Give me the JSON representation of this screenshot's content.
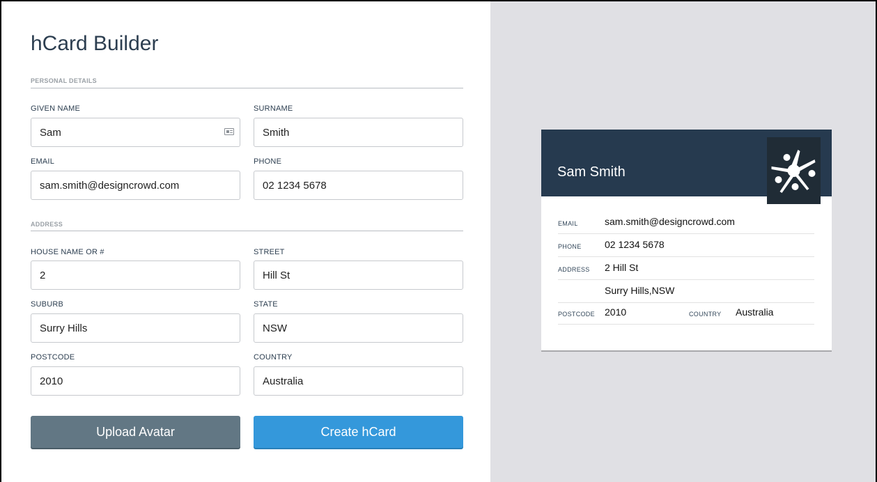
{
  "builder": {
    "title": "hCard Builder",
    "personal_section": "PERSONAL DETAILS",
    "address_section": "ADDRESS",
    "fields": {
      "given_name": {
        "label": "GIVEN NAME",
        "value": "Sam"
      },
      "surname": {
        "label": "SURNAME",
        "value": "Smith"
      },
      "email": {
        "label": "EMAIL",
        "value": "sam.smith@designcrowd.com"
      },
      "phone": {
        "label": "PHONE",
        "value": "02 1234 5678"
      },
      "house": {
        "label": "HOUSE NAME OR #",
        "value": "2"
      },
      "street": {
        "label": "STREET",
        "value": "Hill St"
      },
      "suburb": {
        "label": "SUBURB",
        "value": "Surry Hills"
      },
      "state": {
        "label": "STATE",
        "value": "NSW"
      },
      "postcode": {
        "label": "POSTCODE",
        "value": "2010"
      },
      "country": {
        "label": "COUNTRY",
        "value": "Australia"
      }
    },
    "upload_button": "Upload Avatar",
    "create_button": "Create hCard"
  },
  "preview": {
    "name": "Sam Smith",
    "email_label": "EMAIL",
    "email": "sam.smith@designcrowd.com",
    "phone_label": "PHONE",
    "phone": "02 1234 5678",
    "address_label": "ADDRESS",
    "address_line1": "2 Hill St",
    "address_line2": "Surry Hills,NSW",
    "postcode_label": "POSTCODE",
    "postcode": "2010",
    "country_label": "COUNTRY",
    "country": "Australia"
  },
  "colors": {
    "header": "#263a4f",
    "upload_button": "#627784",
    "create_button": "#3498db",
    "preview_background": "#e0e0e4"
  },
  "icons": {
    "contact_card": "contact-card-icon",
    "avatar": "avatar-logo-icon"
  }
}
